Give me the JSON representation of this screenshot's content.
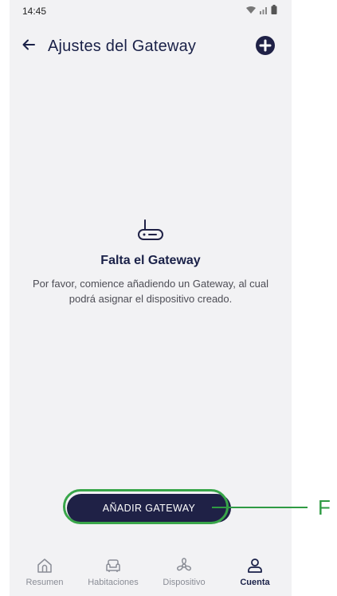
{
  "status_bar": {
    "time": "14:45"
  },
  "header": {
    "title": "Ajustes del Gateway",
    "back_icon": "arrow-left-icon",
    "add_icon": "plus-circle-icon"
  },
  "empty_state": {
    "icon": "router-icon",
    "title": "Falta el Gateway",
    "message": "Por favor, comience añadiendo un Gateway, al cual podrá asignar el dispositivo creado."
  },
  "action": {
    "add_gateway_label": "AÑADIR GATEWAY"
  },
  "annotation": {
    "label": "F",
    "color": "#39a64a"
  },
  "bottom_nav": {
    "items": [
      {
        "label": "Resumen",
        "icon": "home-icon",
        "active": false
      },
      {
        "label": "Habitaciones",
        "icon": "sofa-icon",
        "active": false
      },
      {
        "label": "Dispositivo",
        "icon": "fan-icon",
        "active": false
      },
      {
        "label": "Cuenta",
        "icon": "user-icon",
        "active": true
      }
    ]
  },
  "colors": {
    "primary": "#1f2146",
    "background": "#f2f2f4",
    "accent_annotation": "#39a64a"
  }
}
